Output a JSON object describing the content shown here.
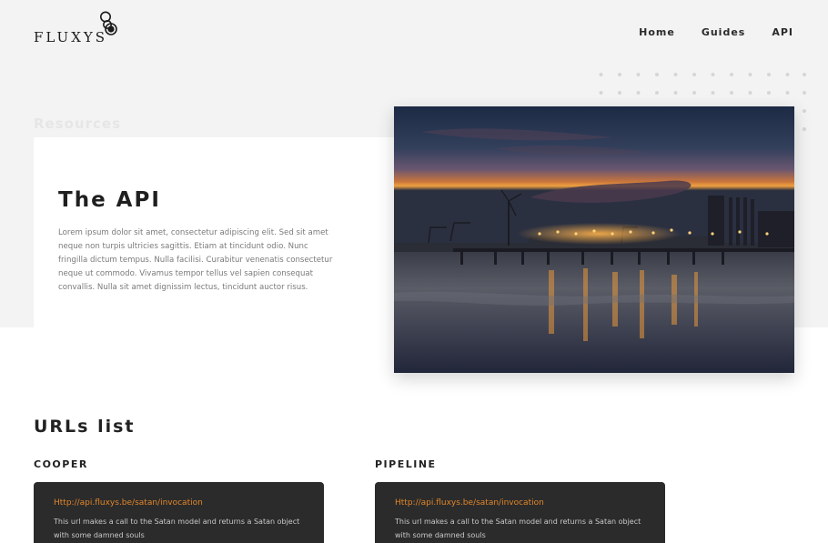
{
  "brand": {
    "name": "FLUXYS",
    "logo_icon": "fluxys-rings-icon"
  },
  "nav": {
    "items": [
      {
        "label": "Home"
      },
      {
        "label": "Guides"
      },
      {
        "label": "API"
      }
    ]
  },
  "hero": {
    "section_label": "Resources",
    "title": "The API",
    "body": "Lorem ipsum dolor sit amet, consectetur adipiscing elit. Sed sit amet neque non turpis ultricies sagittis. Etiam at tincidunt odio. Nunc fringilla dictum tempus. Nulla facilisi. Curabitur venenatis consectetur neque ut commodo. Vivamus tempor tellus vel sapien consequat convallis. Nulla sit amet dignissim lectus, tincidunt auctor risus."
  },
  "urls": {
    "title": "URLs list",
    "columns": [
      {
        "label": "COOPER",
        "url": "Http://api.fluxys.be/satan/invocation",
        "description": "This url makes a call to the Satan model and returns a Satan object with some damned souls"
      },
      {
        "label": "PIPELINE",
        "url": "Http://api.fluxys.be/satan/invocation",
        "description": "This url makes a call to the Satan model and returns a Satan object with some damned souls"
      }
    ]
  },
  "colors": {
    "accent": "#e2862a",
    "hero_background": "#f3f3f3",
    "card_dark": "#2b2b2b",
    "muted_label": "#e6e6e6"
  }
}
